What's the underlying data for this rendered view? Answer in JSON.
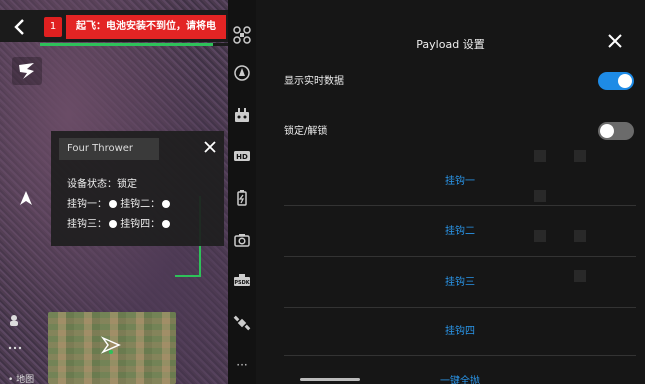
{
  "colors": {
    "accent": "#2a95e8",
    "warning": "#e32424",
    "ok": "#2ec15a",
    "toggle_on": "#1e8be6",
    "toggle_off": "#6b6b6b"
  },
  "warning": {
    "count": "1",
    "message": "起飞：电池安装不到位，请将电",
    "progress": 0.92
  },
  "thrower": {
    "title": "Four Thrower",
    "status_label": "设备状态：锁定",
    "hook1": "挂钩一：",
    "hook2": "挂钩二：",
    "hook3": "挂钩三：",
    "hook4": "挂钩四："
  },
  "map": {
    "label": "地图"
  },
  "tools": [
    {
      "icon": "drone-icon"
    },
    {
      "icon": "gimbal-mode-icon"
    },
    {
      "icon": "payload-icon"
    },
    {
      "icon": "hd-icon"
    },
    {
      "icon": "battery-icon"
    },
    {
      "icon": "camera-icon"
    },
    {
      "icon": "psdk-icon"
    },
    {
      "icon": "satellite-icon"
    },
    {
      "icon": "more-icon"
    }
  ],
  "tool_labels": {
    "hd": "HD",
    "psdk": "PSDK",
    "more": "···"
  },
  "payload": {
    "title": "Payload 设置",
    "show_realtime_label": "显示实时数据",
    "show_realtime_on": true,
    "lock_label": "锁定/解锁",
    "lock_on": false,
    "hook_buttons": [
      "挂钩一",
      "挂钩二",
      "挂钩三",
      "挂钩四",
      "一键全抛"
    ]
  }
}
